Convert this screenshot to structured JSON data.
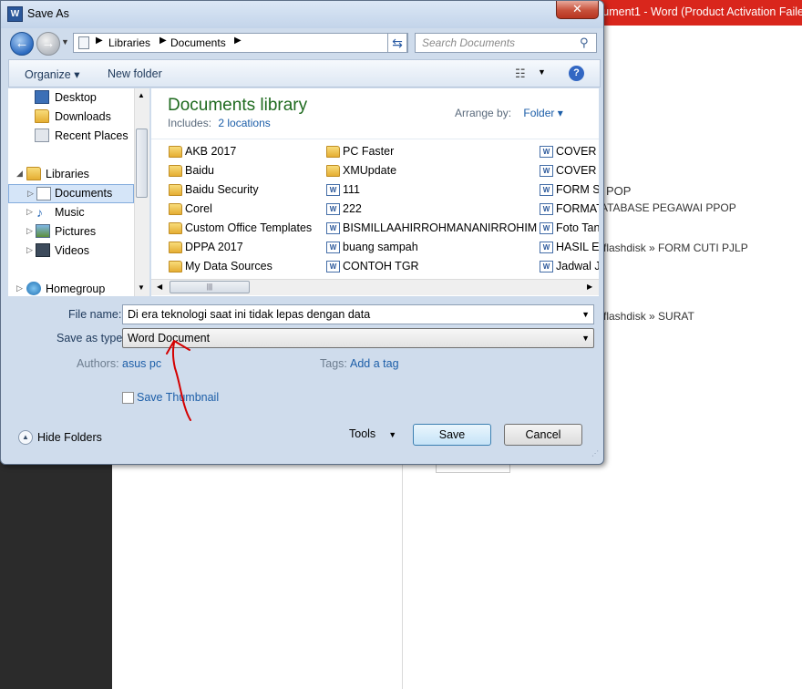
{
  "background_window": {
    "title": "cument1 - Word (Product Activation Faile",
    "text_fragments": [
      "POP",
      "ATABASE PEGAWAI PPOP",
      "flashdisk » FORM CUTI PJLP",
      "flashdisk » SURAT"
    ]
  },
  "dialog": {
    "title": "Save As",
    "close_label": "✕",
    "breadcrumb": [
      "Libraries",
      "Documents"
    ],
    "search_placeholder": "Search Documents",
    "toolbar": {
      "organize": "Organize",
      "new_folder": "New folder"
    },
    "nav": {
      "desktop": "Desktop",
      "downloads": "Downloads",
      "recent": "Recent Places",
      "libraries": "Libraries",
      "documents": "Documents",
      "music": "Music",
      "pictures": "Pictures",
      "videos": "Videos",
      "homegroup": "Homegroup"
    },
    "library": {
      "title": "Documents library",
      "includes_label": "Includes:",
      "includes_link": "2 locations",
      "arrange_label": "Arrange by:",
      "arrange_value": "Folder"
    },
    "files": {
      "col1": [
        "AKB 2017",
        "Baidu",
        "Baidu Security",
        "Corel",
        "Custom Office Templates",
        "DPPA 2017",
        "My Data Sources"
      ],
      "col2": [
        "PC Faster",
        "XMUpdate",
        "111",
        "222",
        "BISMILLAAHIRROHMANANIRROHIM",
        "buang sampah",
        "CONTOH TGR"
      ],
      "col3": [
        "COVER A",
        "COVER A",
        "FORM SI",
        "FORMAT",
        "Foto Tan",
        "HASIL EK",
        "Jadwal Ja"
      ]
    },
    "file_name_label": "File name:",
    "file_name_value": "Di era teknologi saat ini tidak lepas dengan data",
    "save_type_label": "Save as type:",
    "save_type_value": "Word Document",
    "authors_label": "Authors:",
    "authors_value": "asus pc",
    "tags_label": "Tags:",
    "tags_value": "Add a tag",
    "thumbnail_label": "Save Thumbnail",
    "hide_folders": "Hide Folders",
    "tools": "Tools",
    "save": "Save",
    "cancel": "Cancel"
  },
  "colors": {
    "library_title": "#1e6a1e",
    "link": "#1c5ea8",
    "background_titlebar": "#d9261c",
    "annotation_arrow": "#d40000"
  }
}
